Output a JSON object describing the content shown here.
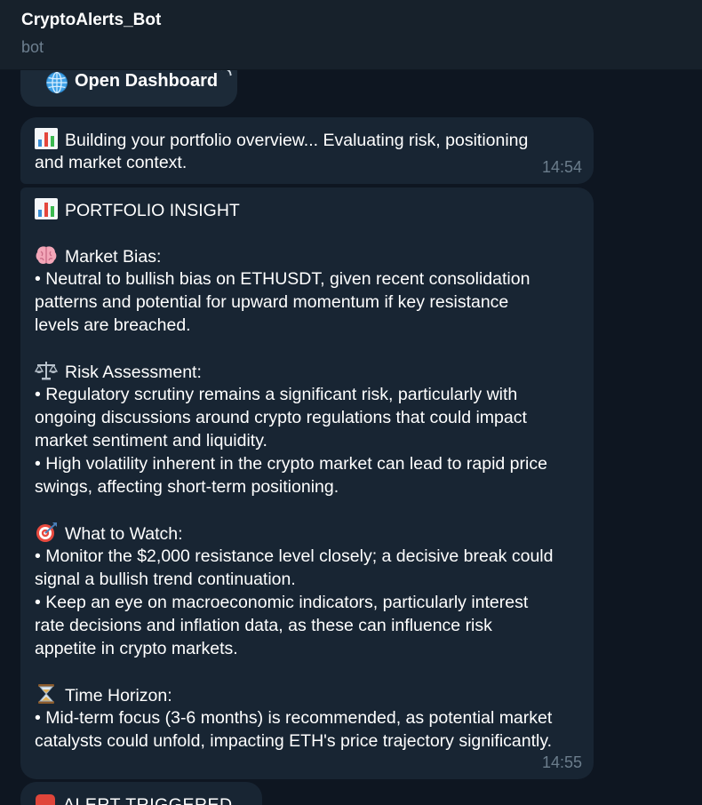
{
  "header": {
    "title": "CryptoAlerts_Bot",
    "subtitle": "bot"
  },
  "dashboard_button": {
    "icon": "globe-icon",
    "label": "Open Dashboard",
    "corner_icon": "external-link-arrow-icon"
  },
  "messages": [
    {
      "icon": "bar-chart-icon",
      "lines": [
        "Building your portfolio overview... Evaluating risk, positioning",
        "and market context."
      ],
      "time": "14:54"
    },
    {
      "title_icon": "bar-chart-icon",
      "title": "PORTFOLIO INSIGHT",
      "sections": [
        {
          "icon": "brain-icon",
          "heading": "Market Bias:",
          "lines": [
            "• Neutral to bullish bias on ETHUSDT, given recent consolidation",
            "patterns and potential for upward momentum if key resistance",
            "levels are breached."
          ]
        },
        {
          "icon": "balance-scale-icon",
          "heading": "Risk Assessment:",
          "lines": [
            "• Regulatory scrutiny remains a significant risk, particularly with",
            "ongoing discussions around crypto regulations that could impact",
            "market sentiment and liquidity.",
            "• High volatility inherent in the crypto market can lead to rapid price",
            "swings, affecting short-term positioning."
          ]
        },
        {
          "icon": "target-icon",
          "heading": "What to Watch:",
          "lines": [
            "• Monitor the $2,000 resistance level closely; a decisive break could",
            "signal a bullish trend continuation.",
            "• Keep an eye on macroeconomic indicators, particularly interest",
            "rate decisions and inflation data, as these can influence risk",
            "appetite in crypto markets."
          ]
        },
        {
          "icon": "hourglass-icon",
          "heading": "Time Horizon:",
          "lines": [
            "• Mid-term focus (3-6 months) is recommended, as potential market",
            "catalysts could unfold, impacting ETH's price trajectory significantly."
          ]
        }
      ],
      "time": "14:55"
    },
    {
      "icon": "alarm-icon",
      "text": "ALERT TRIGGERED"
    }
  ],
  "colors": {
    "background": "#0e1621",
    "header": "#17212b",
    "bubble": "#182533",
    "button": "#1c2a38",
    "timestamp": "#6b7d8c",
    "subtitle": "#6d7f8f"
  }
}
